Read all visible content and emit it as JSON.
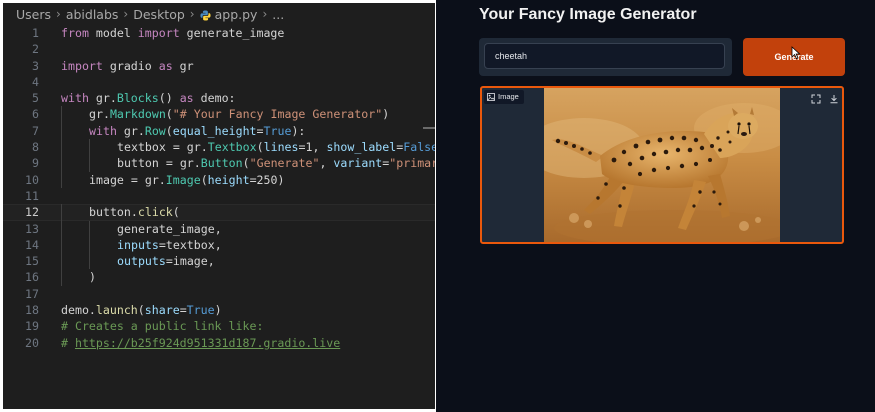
{
  "editor": {
    "breadcrumb": [
      "Users",
      "abidlabs",
      "Desktop",
      "app.py",
      "..."
    ],
    "lines": [
      {
        "n": "1",
        "indent": 0,
        "tokens": [
          [
            "kw",
            "from"
          ],
          [
            "p",
            " model "
          ],
          [
            "kw",
            "import"
          ],
          [
            "p",
            " generate_image"
          ]
        ]
      },
      {
        "n": "2",
        "indent": 0,
        "tokens": []
      },
      {
        "n": "3",
        "indent": 0,
        "tokens": [
          [
            "kw",
            "import"
          ],
          [
            "p",
            " gradio "
          ],
          [
            "kw",
            "as"
          ],
          [
            "p",
            " gr"
          ]
        ]
      },
      {
        "n": "4",
        "indent": 0,
        "tokens": []
      },
      {
        "n": "5",
        "indent": 0,
        "tokens": [
          [
            "kw",
            "with"
          ],
          [
            "p",
            " gr."
          ],
          [
            "cls",
            "Blocks"
          ],
          [
            "p",
            "() "
          ],
          [
            "kw",
            "as"
          ],
          [
            "p",
            " demo:"
          ]
        ]
      },
      {
        "n": "6",
        "indent": 1,
        "tokens": [
          [
            "p",
            "gr."
          ],
          [
            "cls",
            "Markdown"
          ],
          [
            "p",
            "("
          ],
          [
            "str",
            "\"# Your Fancy Image Generator\""
          ],
          [
            "p",
            ")"
          ]
        ]
      },
      {
        "n": "7",
        "indent": 1,
        "tokens": [
          [
            "kw",
            "with"
          ],
          [
            "p",
            " gr."
          ],
          [
            "cls",
            "Row"
          ],
          [
            "p",
            "("
          ],
          [
            "var",
            "equal_height"
          ],
          [
            "p",
            "="
          ],
          [
            "kw2",
            "True"
          ],
          [
            "p",
            "):"
          ]
        ]
      },
      {
        "n": "8",
        "indent": 2,
        "tokens": [
          [
            "p",
            "textbox = gr."
          ],
          [
            "cls",
            "Textbox"
          ],
          [
            "p",
            "("
          ],
          [
            "var",
            "lines"
          ],
          [
            "p",
            "=1, "
          ],
          [
            "var",
            "show_label"
          ],
          [
            "p",
            "="
          ],
          [
            "kw2",
            "False"
          ],
          [
            "p",
            ", p"
          ]
        ]
      },
      {
        "n": "9",
        "indent": 2,
        "tokens": [
          [
            "p",
            "button = gr."
          ],
          [
            "cls",
            "Button"
          ],
          [
            "p",
            "("
          ],
          [
            "str",
            "\"Generate\""
          ],
          [
            "p",
            ", "
          ],
          [
            "var",
            "variant"
          ],
          [
            "p",
            "="
          ],
          [
            "str",
            "\"primary\""
          ],
          [
            "p",
            ")"
          ]
        ]
      },
      {
        "n": "10",
        "indent": 1,
        "tokens": [
          [
            "p",
            "image = gr."
          ],
          [
            "cls",
            "Image"
          ],
          [
            "p",
            "("
          ],
          [
            "var",
            "height"
          ],
          [
            "p",
            "=250)"
          ]
        ]
      },
      {
        "n": "11",
        "indent": 0,
        "tokens": []
      },
      {
        "n": "12",
        "indent": 1,
        "cur": true,
        "tokens": [
          [
            "p",
            "button."
          ],
          [
            "fn",
            "click"
          ],
          [
            "p",
            "("
          ]
        ]
      },
      {
        "n": "13",
        "indent": 2,
        "tokens": [
          [
            "p",
            "generate_image,"
          ]
        ]
      },
      {
        "n": "14",
        "indent": 2,
        "tokens": [
          [
            "var",
            "inputs"
          ],
          [
            "p",
            "=textbox,"
          ]
        ]
      },
      {
        "n": "15",
        "indent": 2,
        "tokens": [
          [
            "var",
            "outputs"
          ],
          [
            "p",
            "=image,"
          ]
        ]
      },
      {
        "n": "16",
        "indent": 1,
        "tokens": [
          [
            "p",
            ")"
          ]
        ]
      },
      {
        "n": "17",
        "indent": 0,
        "tokens": []
      },
      {
        "n": "18",
        "indent": 0,
        "tokens": [
          [
            "p",
            "demo."
          ],
          [
            "fn",
            "launch"
          ],
          [
            "p",
            "("
          ],
          [
            "var",
            "share"
          ],
          [
            "p",
            "="
          ],
          [
            "kw2",
            "True"
          ],
          [
            "p",
            ")"
          ]
        ]
      },
      {
        "n": "19",
        "indent": 0,
        "tokens": [
          [
            "cm",
            "# Creates a public link like:"
          ]
        ]
      },
      {
        "n": "20",
        "indent": 0,
        "tokens": [
          [
            "cm",
            "# "
          ],
          [
            "lnk",
            "https://b25f924d951331d187.gradio.live"
          ]
        ]
      }
    ]
  },
  "app": {
    "title": "Your Fancy Image Generator",
    "textbox_value": "cheetah",
    "button_label": "Generate",
    "image_label": "Image",
    "colors": {
      "accent": "#c2410c",
      "border": "#ea580c",
      "background": "#0b0f19"
    }
  }
}
